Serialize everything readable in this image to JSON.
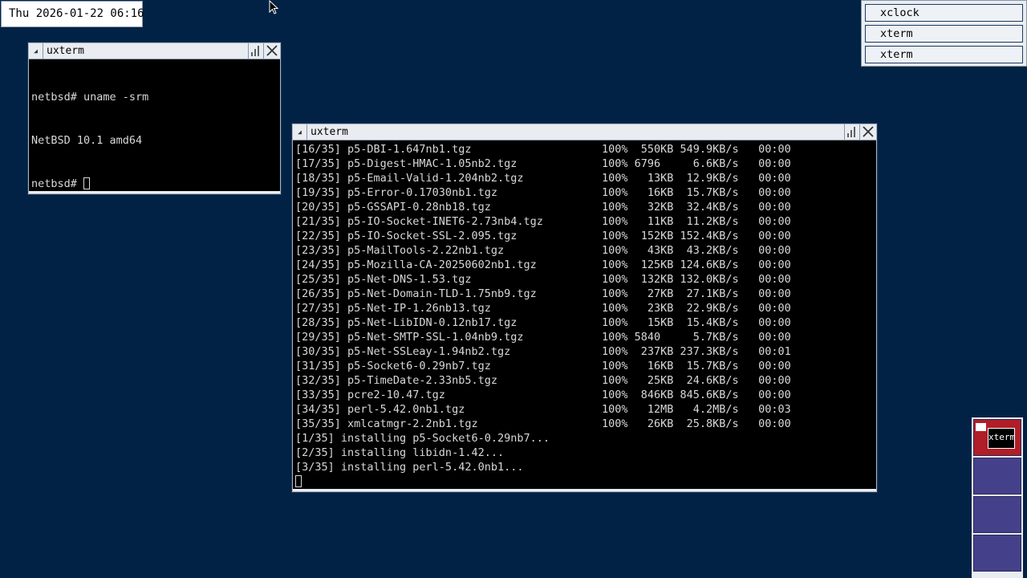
{
  "clock": {
    "text": "Thu 2026-01-22 06:16"
  },
  "windows": {
    "small": {
      "title": "uxterm",
      "lines": [
        "netbsd# uname -srm",
        "NetBSD 10.1 amd64",
        "netbsd# "
      ]
    },
    "large": {
      "title": "uxterm",
      "lines": [
        "[16/35] p5-DBI-1.647nb1.tgz                    100%  550KB 549.9KB/s   00:00",
        "[17/35] p5-Digest-HMAC-1.05nb2.tgz             100% 6796     6.6KB/s   00:00",
        "[18/35] p5-Email-Valid-1.204nb2.tgz            100%   13KB  12.9KB/s   00:00",
        "[19/35] p5-Error-0.17030nb1.tgz                100%   16KB  15.7KB/s   00:00",
        "[20/35] p5-GSSAPI-0.28nb18.tgz                 100%   32KB  32.4KB/s   00:00",
        "[21/35] p5-IO-Socket-INET6-2.73nb4.tgz         100%   11KB  11.2KB/s   00:00",
        "[22/35] p5-IO-Socket-SSL-2.095.tgz             100%  152KB 152.4KB/s   00:00",
        "[23/35] p5-MailTools-2.22nb1.tgz               100%   43KB  43.2KB/s   00:00",
        "[24/35] p5-Mozilla-CA-20250602nb1.tgz          100%  125KB 124.6KB/s   00:00",
        "[25/35] p5-Net-DNS-1.53.tgz                    100%  132KB 132.0KB/s   00:00",
        "[26/35] p5-Net-Domain-TLD-1.75nb9.tgz          100%   27KB  27.1KB/s   00:00",
        "[27/35] p5-Net-IP-1.26nb13.tgz                 100%   23KB  22.9KB/s   00:00",
        "[28/35] p5-Net-LibIDN-0.12nb17.tgz             100%   15KB  15.4KB/s   00:00",
        "[29/35] p5-Net-SMTP-SSL-1.04nb9.tgz            100% 5840     5.7KB/s   00:00",
        "[30/35] p5-Net-SSLeay-1.94nb2.tgz              100%  237KB 237.3KB/s   00:01",
        "[31/35] p5-Socket6-0.29nb7.tgz                 100%   16KB  15.7KB/s   00:00",
        "[32/35] p5-TimeDate-2.33nb5.tgz                100%   25KB  24.6KB/s   00:00",
        "[33/35] pcre2-10.47.tgz                        100%  846KB 845.6KB/s   00:00",
        "[34/35] perl-5.42.0nb1.tgz                     100%   12MB   4.2MB/s   00:03",
        "[35/35] xmlcatmgr-2.2nb1.tgz                   100%   26KB  25.8KB/s   00:00",
        "[1/35] installing p5-Socket6-0.29nb7...",
        "[2/35] installing libidn-1.42...",
        "[3/35] installing perl-5.42.0nb1..."
      ]
    }
  },
  "icon_manager": {
    "items": [
      "xclock",
      "xterm",
      "xterm"
    ]
  },
  "pager": {
    "active_label": "xterm"
  },
  "colors": {
    "desktop": "#022245",
    "pager_active": "#b01e28",
    "pager_inactive": "#45408a"
  }
}
